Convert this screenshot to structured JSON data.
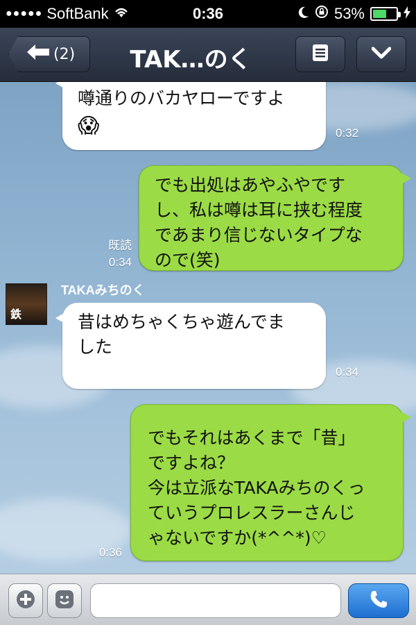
{
  "status_bar": {
    "signal": "●●●●●",
    "carrier": "SoftBank",
    "time": "0:36",
    "battery_percent": "53%",
    "battery_level": 0.53,
    "icons": [
      "wifi-icon",
      "moon-icon",
      "rotation-lock-icon",
      "battery-icon",
      "charging-icon"
    ]
  },
  "nav": {
    "back_label": "(2)",
    "title": "TAK…のく",
    "icons": [
      "back-arrow-icon",
      "menu-icon",
      "chevron-down-icon"
    ]
  },
  "messages": [
    {
      "direction": "in",
      "lines": [
        "噂通りのバカヤローですよ"
      ],
      "emoji": "😱",
      "time": "0:32"
    },
    {
      "direction": "out",
      "lines": [
        "でも出処はあやふやです",
        "し、私は噂は耳に挟む程度",
        "であまり信じないタイプな",
        "ので(笑)"
      ],
      "read_label": "既読",
      "time": "0:34"
    },
    {
      "direction": "in",
      "sender": "TAKAみちのく",
      "lines": [
        "昔はめちゃくちゃ遊んでま",
        "した"
      ],
      "time": "0:34"
    },
    {
      "direction": "out",
      "lines": [
        "でもそれはあくまで「昔」",
        "ですよね？",
        "今は立派なTAKAみちのくっ",
        "ていうプロレスラーさんじ",
        "ゃないですか(*^^*)♡"
      ],
      "time": "0:36"
    }
  ],
  "avatar_text": "鉄",
  "input_bar": {
    "placeholder": "",
    "icons": [
      "plus-icon",
      "emoticon-icon",
      "phone-icon"
    ]
  },
  "colors": {
    "outgoing_bubble": "#9bdb45",
    "incoming_bubble": "#ffffff",
    "call_button": "#1d6fd0"
  }
}
